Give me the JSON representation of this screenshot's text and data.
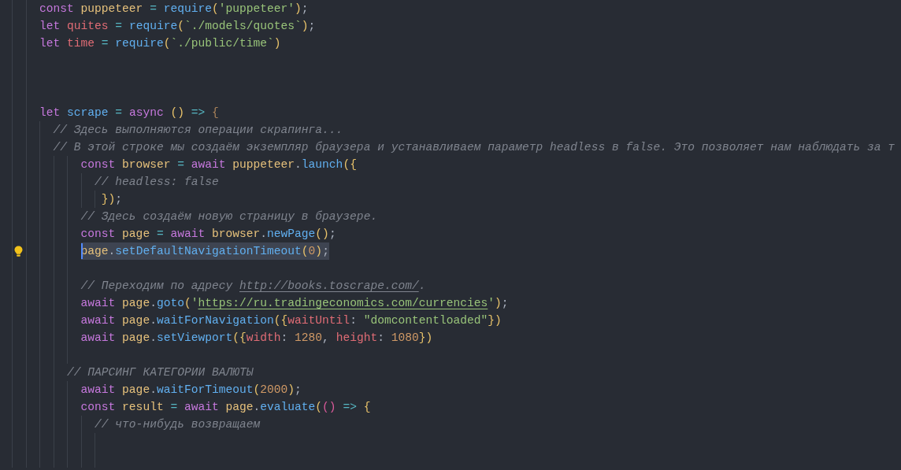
{
  "editor": {
    "lines": [
      {
        "kind": "code",
        "selected": false,
        "tokens": [
          {
            "kind": "keyword",
            "text": "    const "
          },
          {
            "kind": "constant",
            "text": "puppeteer "
          },
          {
            "kind": "operator",
            "text": "= "
          },
          {
            "kind": "function",
            "text": "require"
          },
          {
            "kind": "bracket",
            "text": "("
          },
          {
            "kind": "string",
            "text": "'puppeteer'"
          },
          {
            "kind": "bracket",
            "text": ")"
          },
          {
            "kind": "punctuation",
            "text": ";"
          }
        ]
      },
      {
        "kind": "code",
        "selected": false,
        "tokens": [
          {
            "kind": "keyword",
            "text": "    let "
          },
          {
            "kind": "variable",
            "text": "quites "
          },
          {
            "kind": "operator",
            "text": "= "
          },
          {
            "kind": "function",
            "text": "require"
          },
          {
            "kind": "bracket",
            "text": "("
          },
          {
            "kind": "string",
            "text": "`./models/quotes`"
          },
          {
            "kind": "bracket",
            "text": ")"
          },
          {
            "kind": "punctuation",
            "text": ";"
          }
        ]
      },
      {
        "kind": "code",
        "selected": false,
        "tokens": [
          {
            "kind": "keyword",
            "text": "    let "
          },
          {
            "kind": "variable",
            "text": "time "
          },
          {
            "kind": "operator",
            "text": "= "
          },
          {
            "kind": "function",
            "text": "require"
          },
          {
            "kind": "bracket",
            "text": "("
          },
          {
            "kind": "string",
            "text": "`./public/time`"
          },
          {
            "kind": "bracket",
            "text": ")"
          }
        ]
      },
      {
        "kind": "blank"
      },
      {
        "kind": "blank"
      },
      {
        "kind": "blank"
      },
      {
        "kind": "code",
        "selected": false,
        "tokens": [
          {
            "kind": "keyword",
            "text": "    let "
          },
          {
            "kind": "function",
            "text": "scrape "
          },
          {
            "kind": "operator",
            "text": "= "
          },
          {
            "kind": "keyword",
            "text": "async "
          },
          {
            "kind": "bracket",
            "text": "() "
          },
          {
            "kind": "operator",
            "text": "=> "
          },
          {
            "kind": "bracket_dim",
            "text": "{"
          }
        ]
      },
      {
        "kind": "code",
        "selected": false,
        "tokens": [
          {
            "kind": "comment",
            "text": "      // Здесь выполняются операции скрапинга..."
          }
        ]
      },
      {
        "kind": "code",
        "selected": false,
        "tokens": [
          {
            "kind": "comment",
            "text": "      // В этой строке мы создаём экземпляр браузера и устанавливаем параметр headless в false. Это позволяет нам наблюдать за т"
          }
        ]
      },
      {
        "kind": "code",
        "selected": false,
        "tokens": [
          {
            "kind": "keyword",
            "text": "          const "
          },
          {
            "kind": "constant",
            "text": "browser "
          },
          {
            "kind": "operator",
            "text": "= "
          },
          {
            "kind": "keyword",
            "text": "await "
          },
          {
            "kind": "constant",
            "text": "puppeteer"
          },
          {
            "kind": "punctuation",
            "text": "."
          },
          {
            "kind": "function",
            "text": "launch"
          },
          {
            "kind": "bracket",
            "text": "({"
          }
        ]
      },
      {
        "kind": "code",
        "selected": false,
        "tokens": [
          {
            "kind": "comment",
            "text": "            // headless: false"
          }
        ]
      },
      {
        "kind": "code",
        "selected": false,
        "tokens": [
          {
            "kind": "bracket",
            "text": "             })"
          },
          {
            "kind": "punctuation",
            "text": ";"
          }
        ]
      },
      {
        "kind": "code",
        "selected": false,
        "tokens": [
          {
            "kind": "comment",
            "text": "          // Здесь создаём новую страницу в браузере."
          }
        ]
      },
      {
        "kind": "code",
        "selected": false,
        "tokens": [
          {
            "kind": "keyword",
            "text": "          const "
          },
          {
            "kind": "constant",
            "text": "page "
          },
          {
            "kind": "operator",
            "text": "= "
          },
          {
            "kind": "keyword",
            "text": "await "
          },
          {
            "kind": "constant",
            "text": "browser"
          },
          {
            "kind": "punctuation",
            "text": "."
          },
          {
            "kind": "function",
            "text": "newPage"
          },
          {
            "kind": "bracket",
            "text": "()"
          },
          {
            "kind": "punctuation",
            "text": ";"
          }
        ]
      },
      {
        "kind": "code",
        "selected": true,
        "tokens": [
          {
            "kind": "constant",
            "text": "          page"
          },
          {
            "kind": "punctuation",
            "text": "."
          },
          {
            "kind": "function",
            "text": "setDefaultNavigationTimeout"
          },
          {
            "kind": "bracket",
            "text": "("
          },
          {
            "kind": "number",
            "text": "0"
          },
          {
            "kind": "bracket",
            "text": ")"
          },
          {
            "kind": "punctuation",
            "text": ";"
          }
        ]
      },
      {
        "kind": "blank"
      },
      {
        "kind": "code",
        "selected": false,
        "tokens": [
          {
            "kind": "comment",
            "text": "          // Переходим по адресу "
          },
          {
            "kind": "comment_link",
            "text": "http://books.toscrape.com/"
          },
          {
            "kind": "comment",
            "text": "."
          }
        ]
      },
      {
        "kind": "code",
        "selected": false,
        "tokens": [
          {
            "kind": "keyword",
            "text": "          await "
          },
          {
            "kind": "constant",
            "text": "page"
          },
          {
            "kind": "punctuation",
            "text": "."
          },
          {
            "kind": "function",
            "text": "goto"
          },
          {
            "kind": "bracket",
            "text": "("
          },
          {
            "kind": "string",
            "text": "'"
          },
          {
            "kind": "string_link",
            "text": "https://ru.tradingeconomics.com/currencies"
          },
          {
            "kind": "string",
            "text": "'"
          },
          {
            "kind": "bracket",
            "text": ")"
          },
          {
            "kind": "punctuation",
            "text": ";"
          }
        ]
      },
      {
        "kind": "code",
        "selected": false,
        "tokens": [
          {
            "kind": "keyword",
            "text": "          await "
          },
          {
            "kind": "constant",
            "text": "page"
          },
          {
            "kind": "punctuation",
            "text": "."
          },
          {
            "kind": "function",
            "text": "waitForNavigation"
          },
          {
            "kind": "bracket",
            "text": "({"
          },
          {
            "kind": "property",
            "text": "waitUntil"
          },
          {
            "kind": "punctuation",
            "text": ": "
          },
          {
            "kind": "string",
            "text": "\"domcontentloaded\""
          },
          {
            "kind": "bracket",
            "text": "})"
          }
        ]
      },
      {
        "kind": "code",
        "selected": false,
        "tokens": [
          {
            "kind": "keyword",
            "text": "          await "
          },
          {
            "kind": "constant",
            "text": "page"
          },
          {
            "kind": "punctuation",
            "text": "."
          },
          {
            "kind": "function",
            "text": "setViewport"
          },
          {
            "kind": "bracket",
            "text": "({"
          },
          {
            "kind": "property",
            "text": "width"
          },
          {
            "kind": "punctuation",
            "text": ": "
          },
          {
            "kind": "number",
            "text": "1280"
          },
          {
            "kind": "punctuation",
            "text": ", "
          },
          {
            "kind": "property",
            "text": "height"
          },
          {
            "kind": "punctuation",
            "text": ": "
          },
          {
            "kind": "number",
            "text": "1080"
          },
          {
            "kind": "bracket",
            "text": "})"
          }
        ]
      },
      {
        "kind": "blank"
      },
      {
        "kind": "code",
        "selected": false,
        "tokens": [
          {
            "kind": "comment",
            "text": "        // ПАРСИНГ КАТЕГОРИИ ВАЛЮТЫ"
          }
        ]
      },
      {
        "kind": "code",
        "selected": false,
        "tokens": [
          {
            "kind": "keyword",
            "text": "          await "
          },
          {
            "kind": "constant",
            "text": "page"
          },
          {
            "kind": "punctuation",
            "text": "."
          },
          {
            "kind": "function",
            "text": "waitForTimeout"
          },
          {
            "kind": "bracket",
            "text": "("
          },
          {
            "kind": "number",
            "text": "2000"
          },
          {
            "kind": "bracket",
            "text": ")"
          },
          {
            "kind": "punctuation",
            "text": ";"
          }
        ]
      },
      {
        "kind": "code",
        "selected": false,
        "tokens": [
          {
            "kind": "keyword",
            "text": "          const "
          },
          {
            "kind": "constant",
            "text": "result "
          },
          {
            "kind": "operator",
            "text": "= "
          },
          {
            "kind": "keyword",
            "text": "await "
          },
          {
            "kind": "constant",
            "text": "page"
          },
          {
            "kind": "punctuation",
            "text": "."
          },
          {
            "kind": "function",
            "text": "evaluate"
          },
          {
            "kind": "bracket",
            "text": "("
          },
          {
            "kind": "bracket_nested",
            "text": "() "
          },
          {
            "kind": "operator",
            "text": "=> "
          },
          {
            "kind": "bracket",
            "text": "{"
          }
        ]
      },
      {
        "kind": "code",
        "selected": false,
        "tokens": [
          {
            "kind": "comment",
            "text": "            // что-нибудь возвращаем"
          }
        ]
      },
      {
        "kind": "blank"
      },
      {
        "kind": "blank"
      }
    ]
  }
}
